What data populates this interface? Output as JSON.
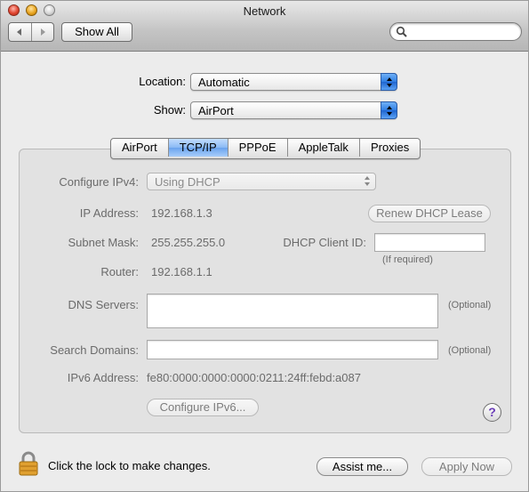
{
  "window": {
    "title": "Network"
  },
  "toolbar": {
    "back_icon": "left-arrow-icon",
    "forward_icon": "right-arrow-icon",
    "show_all": "Show All",
    "search_value": ""
  },
  "location": {
    "label": "Location:",
    "value": "Automatic"
  },
  "show": {
    "label": "Show:",
    "value": "AirPort"
  },
  "tabs": [
    {
      "label": "AirPort",
      "active": false
    },
    {
      "label": "TCP/IP",
      "active": true
    },
    {
      "label": "PPPoE",
      "active": false
    },
    {
      "label": "AppleTalk",
      "active": false
    },
    {
      "label": "Proxies",
      "active": false
    }
  ],
  "tcpip": {
    "configure_label": "Configure IPv4:",
    "configure_value": "Using DHCP",
    "ip_label": "IP Address:",
    "ip_value": "192.168.1.3",
    "renew_button": "Renew DHCP Lease",
    "subnet_label": "Subnet Mask:",
    "subnet_value": "255.255.255.0",
    "client_id_label": "DHCP Client ID:",
    "client_id_value": "",
    "client_id_note": "(If required)",
    "router_label": "Router:",
    "router_value": "192.168.1.1",
    "dns_label": "DNS Servers:",
    "dns_value": "",
    "dns_note": "(Optional)",
    "search_label": "Search Domains:",
    "search_value": "",
    "search_note": "(Optional)",
    "ipv6_label": "IPv6 Address:",
    "ipv6_value": "fe80:0000:0000:0000:0211:24ff:febd:a087",
    "configure_ipv6_button": "Configure IPv6...",
    "help_label": "?"
  },
  "footer": {
    "lock_text": "Click the lock to make changes.",
    "assist_button": "Assist me...",
    "apply_button": "Apply Now"
  },
  "colors": {
    "accent": "#6aa3ee",
    "window_bg": "#ececec",
    "disabled_text": "#6b6b6b"
  }
}
